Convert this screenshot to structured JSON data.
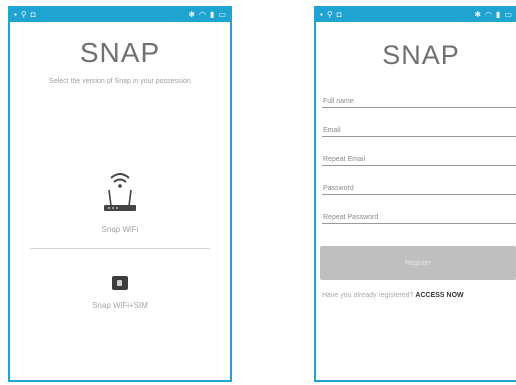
{
  "left_screen": {
    "app_title": "SNAP",
    "subtitle": "Select the version of Snap in your possession",
    "options": [
      {
        "label": "Snap WiFi",
        "icon": "router-icon"
      },
      {
        "label": "Snap WiFi+SIM",
        "icon": "sim-card-icon"
      }
    ]
  },
  "right_screen": {
    "app_title": "SNAP",
    "fields": [
      {
        "label": "Full name"
      },
      {
        "label": "Email"
      },
      {
        "label": "Repeat Email"
      },
      {
        "label": "Password"
      },
      {
        "label": "Repeat Password"
      }
    ],
    "register_label": "Register",
    "login_prompt": "Have you already registered?",
    "access_now_label": "ACCESS NOW"
  },
  "colors": {
    "frame": "#1fa3d1",
    "status_bar": "#1fa3d1",
    "register_button": "#bfbfbf"
  }
}
